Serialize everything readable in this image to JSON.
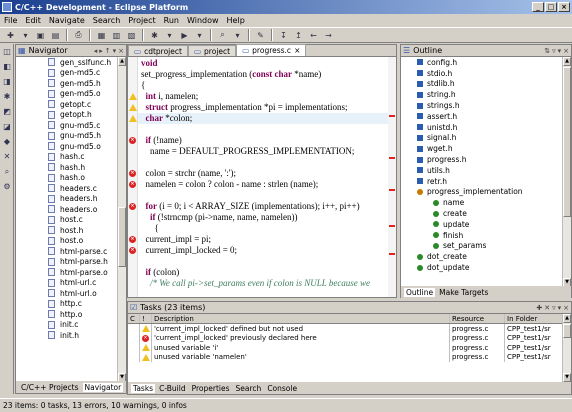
{
  "window": {
    "title": "C/C++ Development - Eclipse Platform",
    "minimize": "_",
    "maximize": "□",
    "close": "×"
  },
  "menu": [
    "File",
    "Edit",
    "Navigate",
    "Search",
    "Project",
    "Run",
    "Window",
    "Help"
  ],
  "navigator": {
    "title": "Navigator",
    "files": [
      {
        "name": "gen_sslfunc.h",
        "icon": "header-file-icon"
      },
      {
        "name": "gen-md5.c",
        "icon": "c-file-icon"
      },
      {
        "name": "gen-md5.h",
        "icon": "header-file-icon"
      },
      {
        "name": "gen-md5.o",
        "icon": "object-file-icon"
      },
      {
        "name": "getopt.c",
        "icon": "c-file-icon"
      },
      {
        "name": "getopt.h",
        "icon": "header-file-icon"
      },
      {
        "name": "gnu-md5.c",
        "icon": "c-file-icon"
      },
      {
        "name": "gnu-md5.h",
        "icon": "header-file-icon"
      },
      {
        "name": "gnu-md5.o",
        "icon": "object-file-icon"
      },
      {
        "name": "hash.c",
        "icon": "c-file-icon"
      },
      {
        "name": "hash.h",
        "icon": "header-file-icon"
      },
      {
        "name": "hash.o",
        "icon": "object-file-icon"
      },
      {
        "name": "headers.c",
        "icon": "c-file-icon"
      },
      {
        "name": "headers.h",
        "icon": "header-file-icon"
      },
      {
        "name": "headers.o",
        "icon": "object-file-icon"
      },
      {
        "name": "host.c",
        "icon": "c-file-icon"
      },
      {
        "name": "host.h",
        "icon": "header-file-icon"
      },
      {
        "name": "host.o",
        "icon": "object-file-icon"
      },
      {
        "name": "html-parse.c",
        "icon": "c-file-icon"
      },
      {
        "name": "html-parse.h",
        "icon": "header-file-icon"
      },
      {
        "name": "html-parse.o",
        "icon": "object-file-icon"
      },
      {
        "name": "html-url.c",
        "icon": "c-file-icon"
      },
      {
        "name": "html-url.o",
        "icon": "object-file-icon"
      },
      {
        "name": "http.c",
        "icon": "c-file-icon"
      },
      {
        "name": "http.o",
        "icon": "object-file-icon"
      },
      {
        "name": "init.c",
        "icon": "c-file-icon"
      },
      {
        "name": "init.h",
        "icon": "header-file-icon"
      }
    ],
    "bottom_tabs": [
      "C/C++ Projects",
      "Navigator"
    ]
  },
  "editor": {
    "tabs": [
      {
        "label": "cdtproject",
        "active": false
      },
      {
        "label": "project",
        "active": false
      },
      {
        "label": "progress.c",
        "active": true,
        "close": "×"
      }
    ],
    "lines": [
      {
        "text": "void",
        "marker": ""
      },
      {
        "text": "set_progress_implementation (const char *name)",
        "marker": ""
      },
      {
        "text": "{",
        "marker": ""
      },
      {
        "text": "  int i, namelen;",
        "marker": "warn"
      },
      {
        "text": "  struct progress_implementation *pi = implementations;",
        "marker": "warn"
      },
      {
        "text": "  char *colon;",
        "marker": "warn"
      },
      {
        "text": "",
        "marker": ""
      },
      {
        "text": "  if (!name)",
        "marker": "err"
      },
      {
        "text": "    name = DEFAULT_PROGRESS_IMPLEMENTATION;",
        "marker": ""
      },
      {
        "text": "",
        "marker": ""
      },
      {
        "text": "  colon = strchr (name, ':');",
        "marker": "err"
      },
      {
        "text": "  namelen = colon ? colon - name : strlen (name);",
        "marker": "err"
      },
      {
        "text": "",
        "marker": ""
      },
      {
        "text": "  for (i = 0; i < ARRAY_SIZE (implementations); i++, pi++)",
        "marker": "err"
      },
      {
        "text": "    if (!strncmp (pi->name, name, namelen))",
        "marker": ""
      },
      {
        "text": "      {",
        "marker": ""
      },
      {
        "text": "  current_impl = pi;",
        "marker": "err"
      },
      {
        "text": "  current_impl_locked = 0;",
        "marker": "err"
      },
      {
        "text": "",
        "marker": ""
      },
      {
        "text": "  if (colon)",
        "marker": ""
      },
      {
        "text": "    /* We call pi->set_params even if colon is NULL because we",
        "marker": ""
      }
    ]
  },
  "outline": {
    "title": "Outline",
    "items": [
      {
        "label": "config.h",
        "indent": 1,
        "kind": "include"
      },
      {
        "label": "stdio.h",
        "indent": 1,
        "kind": "include"
      },
      {
        "label": "stdlib.h",
        "indent": 1,
        "kind": "include"
      },
      {
        "label": "string.h",
        "indent": 1,
        "kind": "include"
      },
      {
        "label": "strings.h",
        "indent": 1,
        "kind": "include"
      },
      {
        "label": "assert.h",
        "indent": 1,
        "kind": "include"
      },
      {
        "label": "unistd.h",
        "indent": 1,
        "kind": "include"
      },
      {
        "label": "signal.h",
        "indent": 1,
        "kind": "include"
      },
      {
        "label": "wget.h",
        "indent": 1,
        "kind": "include"
      },
      {
        "label": "progress.h",
        "indent": 1,
        "kind": "include"
      },
      {
        "label": "utils.h",
        "indent": 1,
        "kind": "include"
      },
      {
        "label": "retr.h",
        "indent": 1,
        "kind": "include"
      },
      {
        "label": "progress_implementation",
        "indent": 1,
        "kind": "struct"
      },
      {
        "label": "name",
        "indent": 2,
        "kind": "field"
      },
      {
        "label": "create",
        "indent": 2,
        "kind": "field"
      },
      {
        "label": "update",
        "indent": 2,
        "kind": "field"
      },
      {
        "label": "finish",
        "indent": 2,
        "kind": "field"
      },
      {
        "label": "set_params",
        "indent": 2,
        "kind": "field"
      },
      {
        "label": "dot_create",
        "indent": 1,
        "kind": "function"
      },
      {
        "label": "dot_update",
        "indent": 1,
        "kind": "function"
      }
    ],
    "bottom_tabs": [
      "Outline",
      "Make Targets"
    ]
  },
  "tasks": {
    "title": "Tasks (23 items)",
    "columns": [
      "C",
      "!",
      "Description",
      "Resource",
      "In Folder"
    ],
    "rows": [
      {
        "kind": "warn",
        "description": "'current_impl_locked' defined but not used",
        "resource": "progress.c",
        "folder": "CPP_test1/sr"
      },
      {
        "kind": "err",
        "description": "'current_impl_locked' previously declared here",
        "resource": "progress.c",
        "folder": "CPP_test1/sr"
      },
      {
        "kind": "warn",
        "description": "unused variable 'i'",
        "resource": "progress.c",
        "folder": "CPP_test1/sr"
      },
      {
        "kind": "warn",
        "description": "unused variable 'namelen'",
        "resource": "progress.c",
        "folder": "CPP_test1/sr"
      }
    ],
    "bottom_tabs": [
      "Tasks",
      "C-Build",
      "Properties",
      "Search",
      "Console"
    ]
  },
  "status": {
    "text": "23 items: 0 tasks, 13 errors, 10 warnings, 0 infos"
  },
  "colors": {
    "keyword": "#7f0055",
    "comment": "#3f7f5f",
    "error": "#dd2222",
    "warning": "#f0c020",
    "titlebar": "#1b3f8f"
  }
}
